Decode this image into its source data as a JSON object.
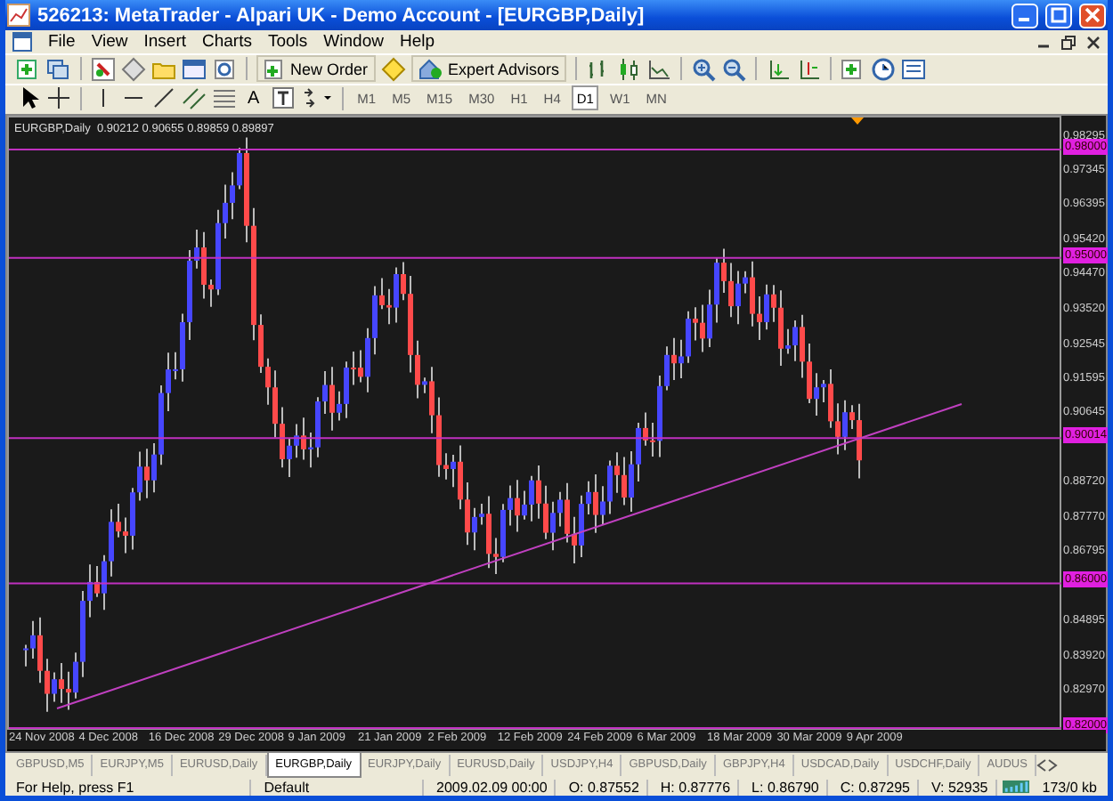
{
  "window": {
    "title": "526213: MetaTrader - Alpari UK - Demo Account - [EURGBP,Daily]"
  },
  "menu": [
    "File",
    "View",
    "Insert",
    "Charts",
    "Tools",
    "Window",
    "Help"
  ],
  "toolbar": {
    "new_order": "New Order",
    "expert_advisors": "Expert Advisors"
  },
  "drawing_tools": {
    "text_tool": "A"
  },
  "timeframes": [
    {
      "label": "M1",
      "selected": false
    },
    {
      "label": "M5",
      "selected": false
    },
    {
      "label": "M15",
      "selected": false
    },
    {
      "label": "M30",
      "selected": false
    },
    {
      "label": "H1",
      "selected": false
    },
    {
      "label": "H4",
      "selected": false
    },
    {
      "label": "D1",
      "selected": true
    },
    {
      "label": "W1",
      "selected": false
    },
    {
      "label": "MN",
      "selected": false
    }
  ],
  "chart": {
    "header": "EURGBP,Daily  0.90212 0.90655 0.89859 0.89897",
    "price_axis": [
      {
        "label": "0.98295",
        "kind": "tick"
      },
      {
        "label": "0.98000",
        "kind": "level"
      },
      {
        "label": "0.97345",
        "kind": "tick"
      },
      {
        "label": "0.96395",
        "kind": "tick"
      },
      {
        "label": "0.95420",
        "kind": "tick"
      },
      {
        "label": "0.95000",
        "kind": "level"
      },
      {
        "label": "0.94470",
        "kind": "tick"
      },
      {
        "label": "0.93520",
        "kind": "tick"
      },
      {
        "label": "0.92545",
        "kind": "tick"
      },
      {
        "label": "0.91595",
        "kind": "tick"
      },
      {
        "label": "0.90645",
        "kind": "tick"
      },
      {
        "label": "0.90014",
        "kind": "level"
      },
      {
        "label": "0.88720",
        "kind": "tick"
      },
      {
        "label": "0.87770",
        "kind": "tick"
      },
      {
        "label": "0.86795",
        "kind": "tick"
      },
      {
        "label": "0.86000",
        "kind": "level"
      },
      {
        "label": "0.84895",
        "kind": "tick"
      },
      {
        "label": "0.83920",
        "kind": "tick"
      },
      {
        "label": "0.82970",
        "kind": "tick"
      },
      {
        "label": "0.82000",
        "kind": "level"
      }
    ],
    "dates": [
      "24 Nov 2008",
      "4 Dec 2008",
      "16 Dec 2008",
      "29 Dec 2008",
      "9 Jan 2009",
      "21 Jan 2009",
      "2 Feb 2009",
      "12 Feb 2009",
      "24 Feb 2009",
      "6 Mar 2009",
      "18 Mar 2009",
      "30 Mar 2009",
      "9 Apr 2009"
    ]
  },
  "tabs": [
    {
      "label": "GBPUSD,M5",
      "selected": false
    },
    {
      "label": "EURJPY,M5",
      "selected": false
    },
    {
      "label": "EURUSD,Daily",
      "selected": false
    },
    {
      "label": "EURGBP,Daily",
      "selected": true
    },
    {
      "label": "EURJPY,Daily",
      "selected": false
    },
    {
      "label": "EURUSD,Daily",
      "selected": false
    },
    {
      "label": "USDJPY,H4",
      "selected": false
    },
    {
      "label": "GBPUSD,Daily",
      "selected": false
    },
    {
      "label": "GBPJPY,H4",
      "selected": false
    },
    {
      "label": "USDCAD,Daily",
      "selected": false
    },
    {
      "label": "USDCHF,Daily",
      "selected": false
    },
    {
      "label": "AUDUS",
      "selected": false
    }
  ],
  "status_bar": {
    "help": "For Help, press F1",
    "profile": "Default",
    "time": "2009.02.09 00:00",
    "open": "O: 0.87552",
    "high": "H: 0.87776",
    "low": "L: 0.86790",
    "close": "C: 0.87295",
    "volume": "V: 52935",
    "traffic": "173/0 kb"
  }
}
